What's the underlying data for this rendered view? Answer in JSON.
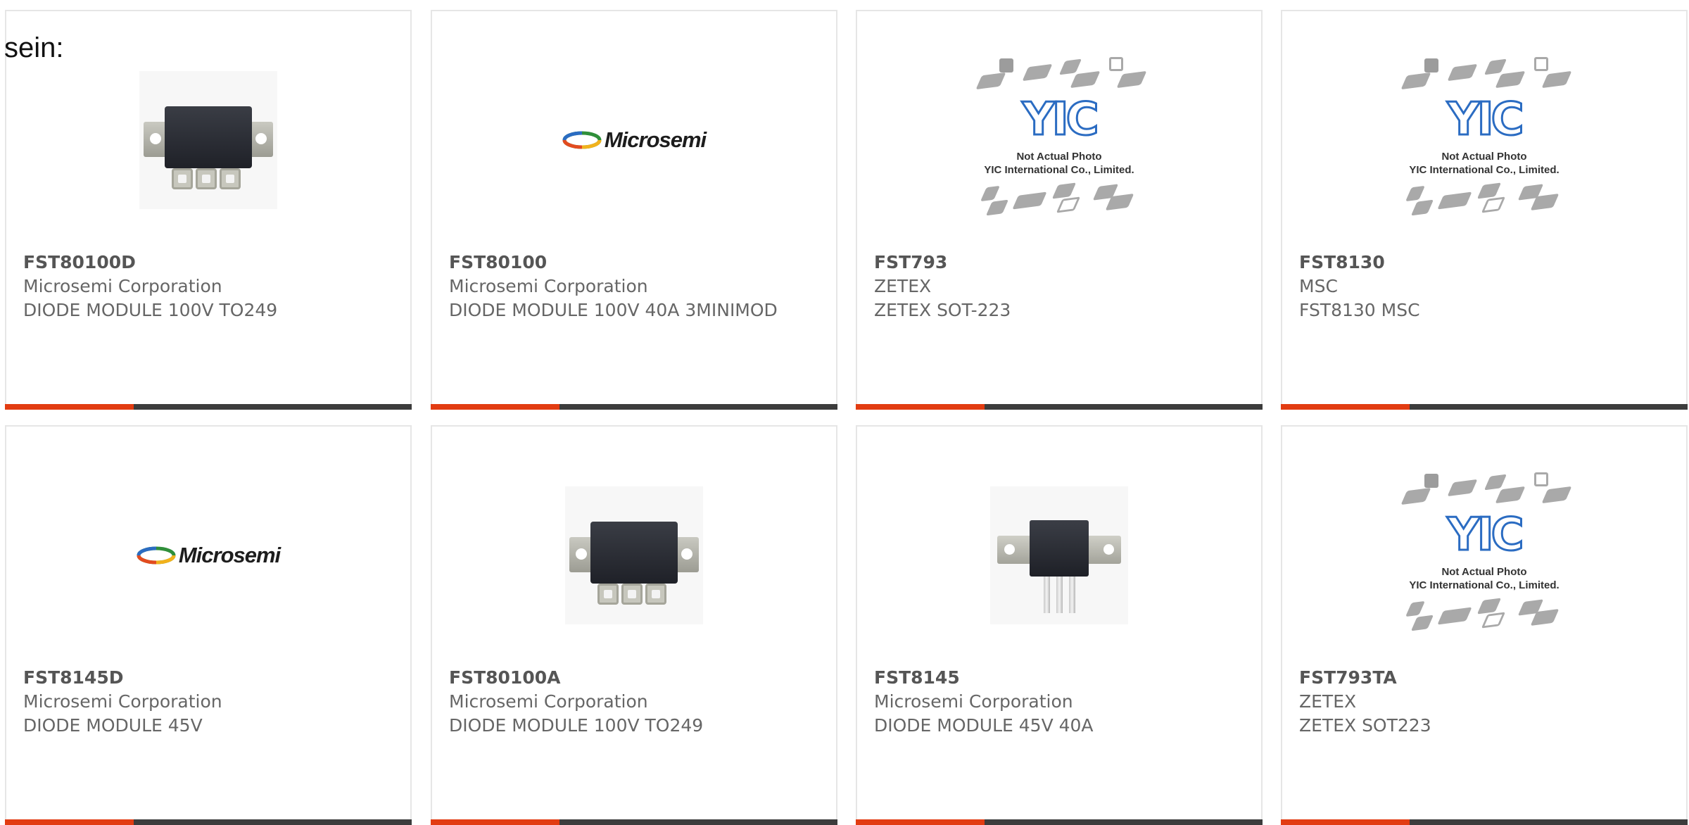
{
  "intro_text": "sein:",
  "colors": {
    "accent_bar": "#e23c12",
    "base_bar": "#3c3c3c",
    "text": "#666666",
    "part_number": "#555555",
    "yic_blue": "#2b6cc2"
  },
  "products": [
    {
      "part_number": "FST80100D",
      "manufacturer": "Microsemi Corporation",
      "description": "DIODE MODULE 100V TO249",
      "image_type": "module-photo"
    },
    {
      "part_number": "FST80100",
      "manufacturer": "Microsemi Corporation",
      "description": "DIODE MODULE 100V 40A 3MINIMOD",
      "image_type": "microsemi-logo",
      "logo_text": "Microsemi"
    },
    {
      "part_number": "FST793",
      "manufacturer": "ZETEX",
      "description": "ZETEX SOT-223",
      "image_type": "yic-placeholder",
      "placeholder_line1": "Not Actual Photo",
      "placeholder_line2": "YIC International Co., Limited."
    },
    {
      "part_number": "FST8130",
      "manufacturer": "MSC",
      "description": "FST8130 MSC",
      "image_type": "yic-placeholder",
      "placeholder_line1": "Not Actual Photo",
      "placeholder_line2": "YIC International Co., Limited."
    },
    {
      "part_number": "FST8145D",
      "manufacturer": "Microsemi Corporation",
      "description": "DIODE MODULE 45V",
      "image_type": "microsemi-logo",
      "logo_text": "Microsemi"
    },
    {
      "part_number": "FST80100A",
      "manufacturer": "Microsemi Corporation",
      "description": "DIODE MODULE 100V TO249",
      "image_type": "module-photo"
    },
    {
      "part_number": "FST8145",
      "manufacturer": "Microsemi Corporation",
      "description": "DIODE MODULE 45V 40A",
      "image_type": "to-package-photo"
    },
    {
      "part_number": "FST793TA",
      "manufacturer": "ZETEX",
      "description": "ZETEX SOT223",
      "image_type": "yic-placeholder",
      "placeholder_line1": "Not Actual Photo",
      "placeholder_line2": "YIC International Co., Limited."
    }
  ]
}
